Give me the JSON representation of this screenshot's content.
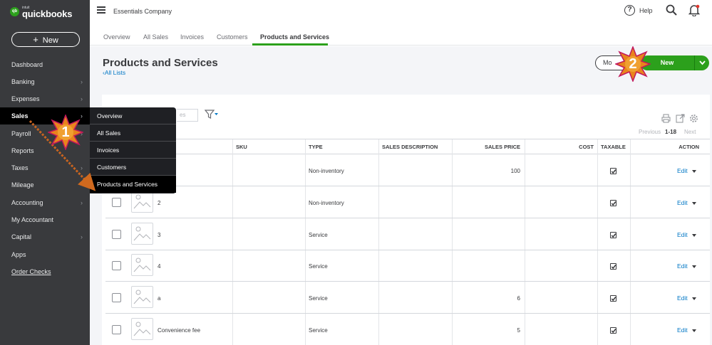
{
  "brand": {
    "intuit": "intuit",
    "name": "quickbooks",
    "mark": "qb"
  },
  "sidebar": {
    "new_label": "New",
    "items": [
      {
        "label": "Dashboard",
        "chevron": false
      },
      {
        "label": "Banking",
        "chevron": true
      },
      {
        "label": "Expenses",
        "chevron": true
      },
      {
        "label": "Sales",
        "chevron": true,
        "active": true
      },
      {
        "label": "Payroll",
        "chevron": true
      },
      {
        "label": "Reports",
        "chevron": false
      },
      {
        "label": "Taxes",
        "chevron": true
      },
      {
        "label": "Mileage",
        "chevron": false
      },
      {
        "label": "Accounting",
        "chevron": true
      },
      {
        "label": "My Accountant",
        "chevron": false
      },
      {
        "label": "Capital",
        "chevron": true
      },
      {
        "label": "Apps",
        "chevron": false
      },
      {
        "label": "Order Checks",
        "chevron": false,
        "link": true
      }
    ]
  },
  "flyout": {
    "items": [
      "Overview",
      "All Sales",
      "Invoices",
      "Customers",
      "Products and Services"
    ]
  },
  "topbar": {
    "company": "Essentials Company",
    "help": "Help"
  },
  "subtabs": [
    "Overview",
    "All Sales",
    "Invoices",
    "Customers",
    "Products and Services"
  ],
  "page": {
    "title": "Products and Services",
    "back_link": "All Lists",
    "more_label": "Mo",
    "new_label": "New",
    "filter_placeholder": "es"
  },
  "pager": {
    "previous": "Previous",
    "range": "1-18",
    "next": "Next"
  },
  "table": {
    "headers": [
      "SKU",
      "TYPE",
      "SALES DESCRIPTION",
      "SALES PRICE",
      "COST",
      "TAXABLE",
      "ACTION"
    ],
    "rows": [
      {
        "name": "",
        "sku": "",
        "type": "Non-inventory",
        "description": "",
        "price": "100",
        "cost": "",
        "taxable": true,
        "action": "Edit"
      },
      {
        "name": "2",
        "sku": "",
        "type": "Non-inventory",
        "description": "",
        "price": "",
        "cost": "",
        "taxable": true,
        "action": "Edit"
      },
      {
        "name": "3",
        "sku": "",
        "type": "Service",
        "description": "",
        "price": "",
        "cost": "",
        "taxable": true,
        "action": "Edit"
      },
      {
        "name": "4",
        "sku": "",
        "type": "Service",
        "description": "",
        "price": "",
        "cost": "",
        "taxable": true,
        "action": "Edit"
      },
      {
        "name": "a",
        "sku": "",
        "type": "Service",
        "description": "",
        "price": "6",
        "cost": "",
        "taxable": true,
        "action": "Edit"
      },
      {
        "name": "Convenience fee",
        "sku": "",
        "type": "Service",
        "description": "",
        "price": "5",
        "cost": "",
        "taxable": true,
        "action": "Edit"
      }
    ]
  },
  "callouts": [
    {
      "number": "1"
    },
    {
      "number": "2"
    }
  ],
  "colors": {
    "sidebar": "#393a3d",
    "accent_green": "#2ca01c",
    "link_blue": "#0077c5",
    "callout_orange": "#f5a623"
  }
}
